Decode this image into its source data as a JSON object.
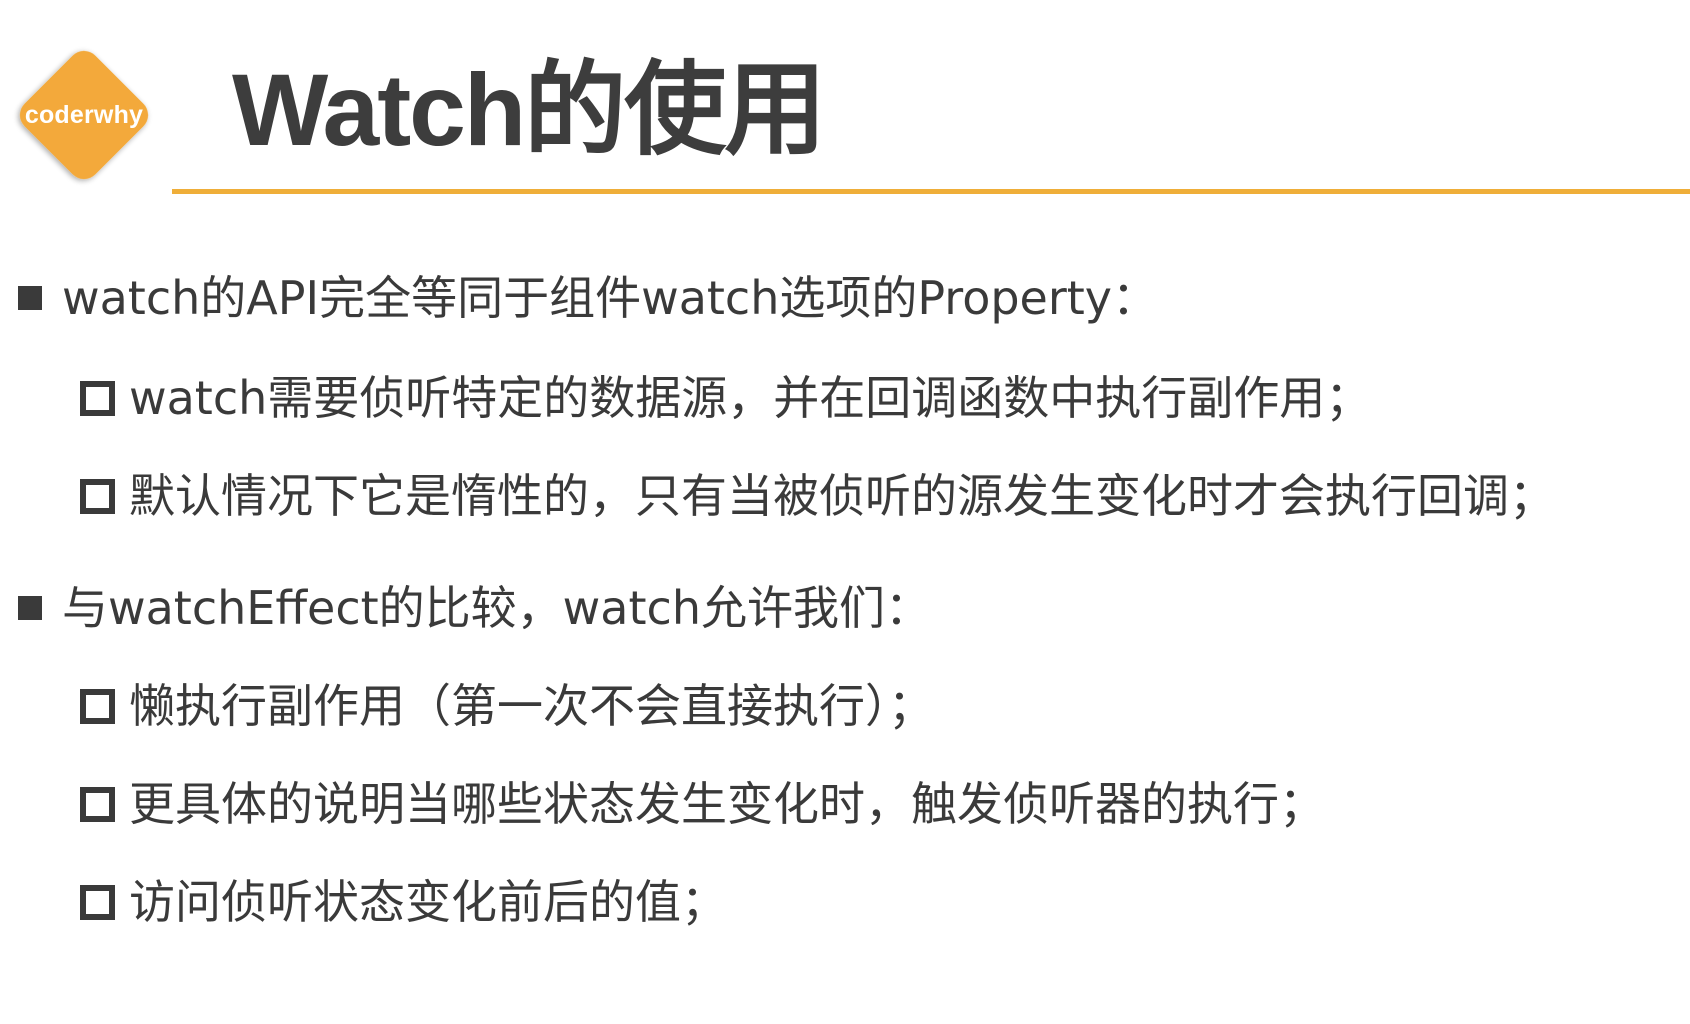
{
  "logo": {
    "text": "coderwhy",
    "color": "#f3a93a"
  },
  "title": "Watch的使用",
  "accent_color": "#efae39",
  "sections": [
    {
      "text": "watch的API完全等同于组件watch选项的Property：",
      "bullet": "filled-square-icon",
      "items": [
        {
          "text": "watch需要侦听特定的数据源，并在回调函数中执行副作用；",
          "bullet": "hollow-square-icon"
        },
        {
          "text": "默认情况下它是惰性的，只有当被侦听的源发生变化时才会执行回调；",
          "bullet": "hollow-square-icon"
        }
      ]
    },
    {
      "text": "与watchEffect的比较，watch允许我们：",
      "bullet": "filled-square-icon",
      "items": [
        {
          "text": "懒执行副作用（第一次不会直接执行）；",
          "bullet": "hollow-square-icon"
        },
        {
          "text": "更具体的说明当哪些状态发生变化时，触发侦听器的执行；",
          "bullet": "hollow-square-icon"
        },
        {
          "text": "访问侦听状态变化前后的值；",
          "bullet": "hollow-square-icon"
        }
      ]
    }
  ]
}
